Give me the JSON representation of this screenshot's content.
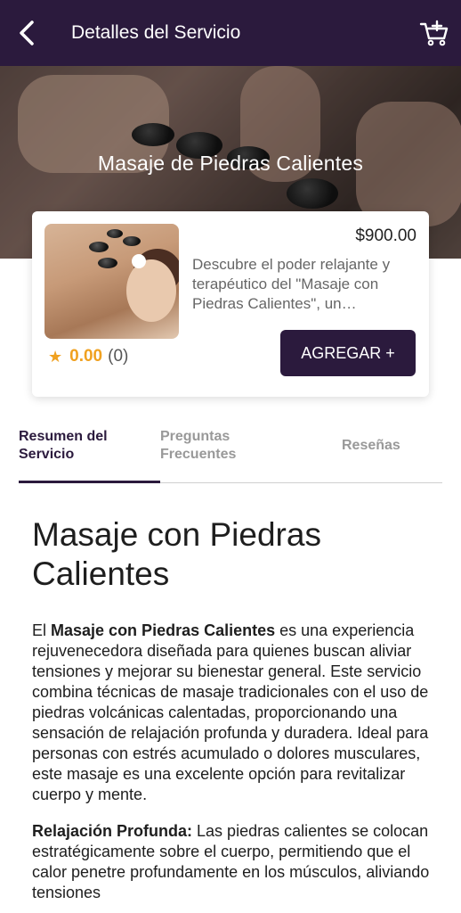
{
  "header": {
    "title": "Detalles del Servicio",
    "back_icon": "arrow-left-icon",
    "cart_icon": "cart-add-icon"
  },
  "hero": {
    "title": "Masaje de Piedras Calientes"
  },
  "service_card": {
    "price": "$900.00",
    "description": "Descubre el poder relajante y terapéutico del \"Masaje con Piedras Calientes\", un…",
    "rating_value": "0.00",
    "rating_count": "(0)",
    "add_button_label": "AGREGAR +"
  },
  "tabs": [
    {
      "label": "Resumen del Servicio",
      "active": true
    },
    {
      "label": "Preguntas Frecuentes",
      "active": false
    },
    {
      "label": "Reseñas",
      "active": false
    }
  ],
  "content": {
    "heading": "Masaje con Piedras Calientes",
    "para1_prefix": "El ",
    "para1_bold": "Masaje con Piedras Calientes",
    "para1_rest": " es una experiencia rejuvenecedora diseñada para quienes buscan aliviar tensiones y mejorar su bienestar general. Este servicio combina técnicas de masaje tradicionales con el uso de piedras volcánicas calentadas, proporcionando una sensación de relajación profunda y duradera. Ideal para personas con estrés acumulado o dolores musculares, este masaje es una excelente opción para revitalizar cuerpo y mente.",
    "para2_bold": "Relajación Profunda:",
    "para2_rest": " Las piedras calientes se colocan estratégicamente sobre el cuerpo, permitiendo que el calor penetre profundamente en los músculos, aliviando tensiones"
  },
  "colors": {
    "primary": "#2b1a3d",
    "star": "#f0a120"
  }
}
